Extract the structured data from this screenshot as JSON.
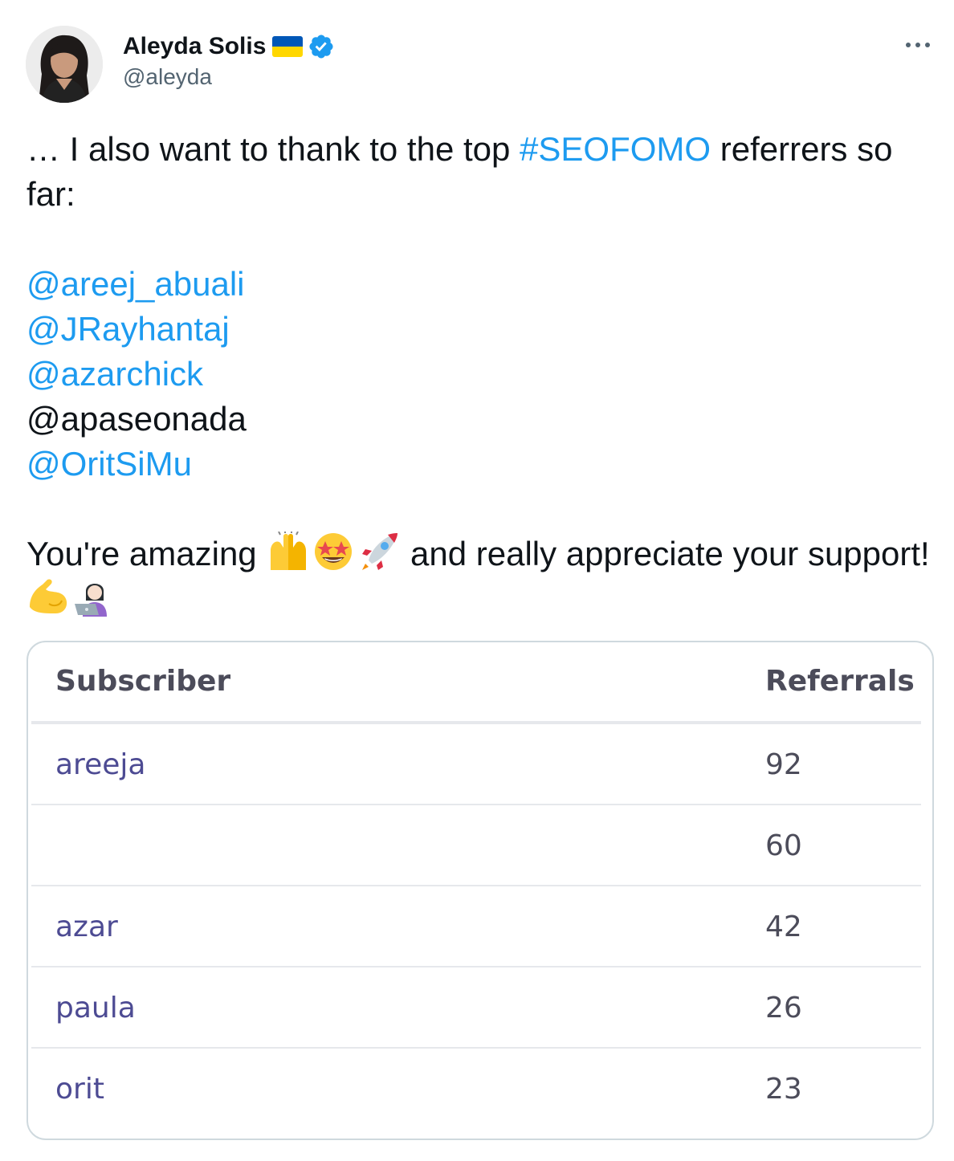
{
  "author": {
    "display_name": "Aleyda Solis",
    "handle": "@aleyda",
    "flag_icon": "ukraine-flag-icon",
    "verified_icon": "verified-badge-icon"
  },
  "tweet": {
    "line1_prefix": "… I also want to thank to the top ",
    "hashtag": "#SEOFOMO",
    "line1_suffix": " referrers so far:",
    "mentions": [
      {
        "text": "@areej_abuali",
        "is_link": true
      },
      {
        "text": "@JRayhantaj",
        "is_link": true
      },
      {
        "text": "@azarchick",
        "is_link": true
      },
      {
        "text": "@apaseonada",
        "is_link": false
      },
      {
        "text": "@OritSiMu",
        "is_link": true
      }
    ],
    "closing_part1": "You're amazing ",
    "closing_part2": " and really appreciate your support! ",
    "emojis_1": [
      "raising-hands-emoji",
      "star-struck-emoji",
      "rocket-emoji"
    ],
    "emojis_2": [
      "flexed-biceps-emoji",
      "woman-technologist-emoji"
    ]
  },
  "table": {
    "headers": {
      "subscriber": "Subscriber",
      "referrals": "Referrals"
    },
    "rows": [
      {
        "subscriber": "areeja",
        "referrals": "92"
      },
      {
        "subscriber": "",
        "referrals": "60"
      },
      {
        "subscriber": "azar",
        "referrals": "42"
      },
      {
        "subscriber": "paula",
        "referrals": "26"
      },
      {
        "subscriber": "orit",
        "referrals": "23"
      }
    ]
  },
  "colors": {
    "link": "#1d9bf0",
    "subscriber_text": "#4d4b93",
    "muted": "#536471"
  }
}
